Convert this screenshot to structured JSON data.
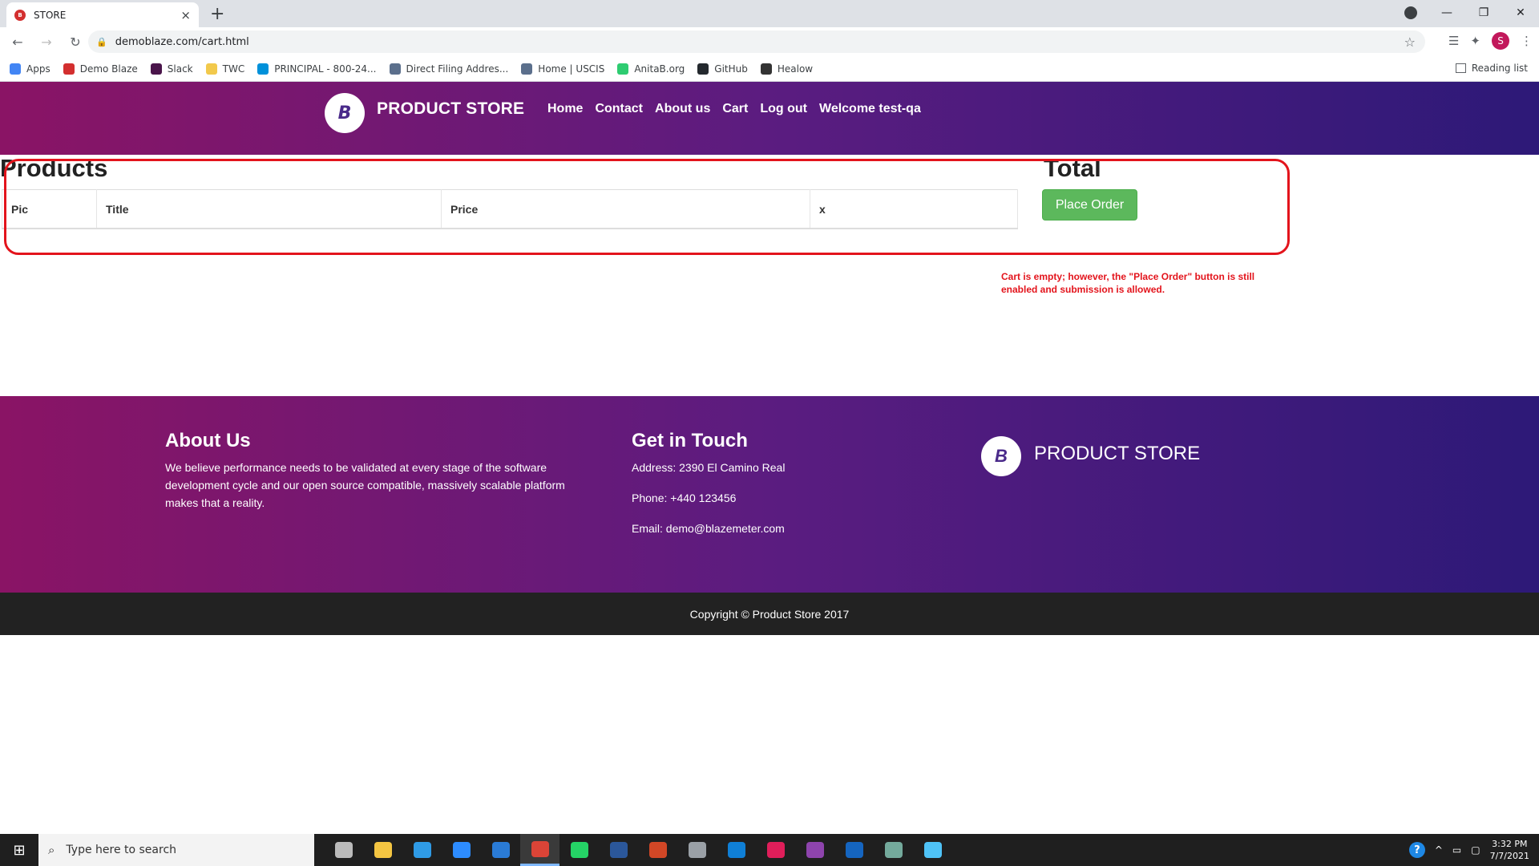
{
  "browser": {
    "tab_title": "STORE",
    "tab_close": "×",
    "new_tab": "+",
    "url": "demoblaze.com/cart.html",
    "bookmarks": [
      {
        "label": "Apps",
        "icon": "apps-grid-icon",
        "color": "#4285f4"
      },
      {
        "label": "Demo Blaze",
        "icon": "demoblaze-icon",
        "color": "#d32f2f"
      },
      {
        "label": "Slack",
        "icon": "slack-icon",
        "color": "#4a154b"
      },
      {
        "label": "TWC",
        "icon": "twc-icon",
        "color": "#f2c94c"
      },
      {
        "label": "PRINCIPAL - 800-24...",
        "icon": "principal-icon",
        "color": "#0091da"
      },
      {
        "label": "Direct Filing Addres...",
        "icon": "uscis-seal-icon",
        "color": "#5b6f8c"
      },
      {
        "label": "Home | USCIS",
        "icon": "uscis-seal-icon",
        "color": "#5b6f8c"
      },
      {
        "label": "AnitaB.org",
        "icon": "anitab-icon",
        "color": "#2ecc71"
      },
      {
        "label": "GitHub",
        "icon": "github-icon",
        "color": "#24292e"
      },
      {
        "label": "Healow",
        "icon": "healow-icon",
        "color": "#333333"
      }
    ],
    "reading_list": "Reading list",
    "profile_initial": "S"
  },
  "site": {
    "brand": "PRODUCT STORE",
    "logo_letter": "B",
    "nav": [
      "Home",
      "Contact",
      "About us",
      "Cart",
      "Log out",
      "Welcome test-qa"
    ]
  },
  "cart": {
    "products_heading": "Products",
    "total_heading": "Total",
    "columns": [
      "Pic",
      "Title",
      "Price",
      "x"
    ],
    "place_order": "Place Order"
  },
  "annotation": {
    "text": "Cart is empty; however, the \"Place Order\" button is still enabled and submission is allowed.",
    "color": "#e3141c"
  },
  "footer": {
    "about_title": "About Us",
    "about_text": "We believe performance needs to be validated at every stage of the software development cycle and our open source compatible, massively scalable platform makes that a reality.",
    "contact_title": "Get in Touch",
    "address": "Address: 2390 El Camino Real",
    "phone": "Phone: +440 123456",
    "email": "Email: demo@blazemeter.com",
    "brand": "PRODUCT STORE",
    "copyright": "Copyright © Product Store 2017"
  },
  "taskbar": {
    "search_placeholder": "Type here to search",
    "time": "3:32 PM",
    "date": "7/7/2021",
    "apps": [
      {
        "icon": "task-view-icon",
        "color": "#bbbbbb"
      },
      {
        "icon": "file-explorer-icon",
        "color": "#f4c542"
      },
      {
        "icon": "vscode-icon",
        "color": "#2f9be6"
      },
      {
        "icon": "zoom-icon",
        "color": "#2d8cff"
      },
      {
        "icon": "mail-icon",
        "color": "#2a7bd6"
      },
      {
        "icon": "chrome-icon",
        "color": "#db4437"
      },
      {
        "icon": "whatsapp-icon",
        "color": "#25d366"
      },
      {
        "icon": "word-icon",
        "color": "#2b579a"
      },
      {
        "icon": "powerpoint-icon",
        "color": "#d24726"
      },
      {
        "icon": "printer-icon",
        "color": "#9aa0a6"
      },
      {
        "icon": "store-icon",
        "color": "#0f7fd6"
      },
      {
        "icon": "slack-icon",
        "color": "#e01e5a"
      },
      {
        "icon": "github-desktop-icon",
        "color": "#8e44ad"
      },
      {
        "icon": "selenium-icon",
        "color": "#1565c0"
      },
      {
        "icon": "chatgpt-icon",
        "color": "#74aa9c"
      },
      {
        "icon": "notepad-icon",
        "color": "#4fc3f7"
      }
    ]
  }
}
